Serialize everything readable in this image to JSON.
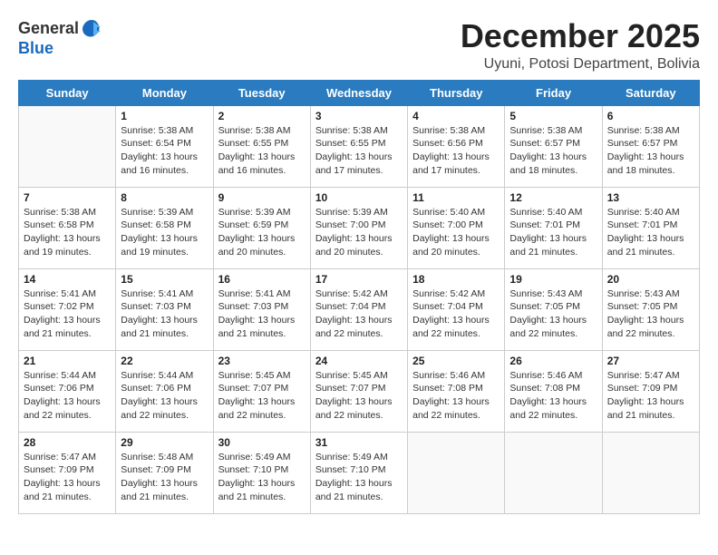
{
  "logo": {
    "text_general": "General",
    "text_blue": "Blue",
    "icon": "▶"
  },
  "title": "December 2025",
  "subtitle": "Uyuni, Potosi Department, Bolivia",
  "days_of_week": [
    "Sunday",
    "Monday",
    "Tuesday",
    "Wednesday",
    "Thursday",
    "Friday",
    "Saturday"
  ],
  "weeks": [
    [
      {
        "day": "",
        "info": ""
      },
      {
        "day": "1",
        "info": "Sunrise: 5:38 AM\nSunset: 6:54 PM\nDaylight: 13 hours and 16 minutes."
      },
      {
        "day": "2",
        "info": "Sunrise: 5:38 AM\nSunset: 6:55 PM\nDaylight: 13 hours and 16 minutes."
      },
      {
        "day": "3",
        "info": "Sunrise: 5:38 AM\nSunset: 6:55 PM\nDaylight: 13 hours and 17 minutes."
      },
      {
        "day": "4",
        "info": "Sunrise: 5:38 AM\nSunset: 6:56 PM\nDaylight: 13 hours and 17 minutes."
      },
      {
        "day": "5",
        "info": "Sunrise: 5:38 AM\nSunset: 6:57 PM\nDaylight: 13 hours and 18 minutes."
      },
      {
        "day": "6",
        "info": "Sunrise: 5:38 AM\nSunset: 6:57 PM\nDaylight: 13 hours and 18 minutes."
      }
    ],
    [
      {
        "day": "7",
        "info": "Sunrise: 5:38 AM\nSunset: 6:58 PM\nDaylight: 13 hours and 19 minutes."
      },
      {
        "day": "8",
        "info": "Sunrise: 5:39 AM\nSunset: 6:58 PM\nDaylight: 13 hours and 19 minutes."
      },
      {
        "day": "9",
        "info": "Sunrise: 5:39 AM\nSunset: 6:59 PM\nDaylight: 13 hours and 20 minutes."
      },
      {
        "day": "10",
        "info": "Sunrise: 5:39 AM\nSunset: 7:00 PM\nDaylight: 13 hours and 20 minutes."
      },
      {
        "day": "11",
        "info": "Sunrise: 5:40 AM\nSunset: 7:00 PM\nDaylight: 13 hours and 20 minutes."
      },
      {
        "day": "12",
        "info": "Sunrise: 5:40 AM\nSunset: 7:01 PM\nDaylight: 13 hours and 21 minutes."
      },
      {
        "day": "13",
        "info": "Sunrise: 5:40 AM\nSunset: 7:01 PM\nDaylight: 13 hours and 21 minutes."
      }
    ],
    [
      {
        "day": "14",
        "info": "Sunrise: 5:41 AM\nSunset: 7:02 PM\nDaylight: 13 hours and 21 minutes."
      },
      {
        "day": "15",
        "info": "Sunrise: 5:41 AM\nSunset: 7:03 PM\nDaylight: 13 hours and 21 minutes."
      },
      {
        "day": "16",
        "info": "Sunrise: 5:41 AM\nSunset: 7:03 PM\nDaylight: 13 hours and 21 minutes."
      },
      {
        "day": "17",
        "info": "Sunrise: 5:42 AM\nSunset: 7:04 PM\nDaylight: 13 hours and 22 minutes."
      },
      {
        "day": "18",
        "info": "Sunrise: 5:42 AM\nSunset: 7:04 PM\nDaylight: 13 hours and 22 minutes."
      },
      {
        "day": "19",
        "info": "Sunrise: 5:43 AM\nSunset: 7:05 PM\nDaylight: 13 hours and 22 minutes."
      },
      {
        "day": "20",
        "info": "Sunrise: 5:43 AM\nSunset: 7:05 PM\nDaylight: 13 hours and 22 minutes."
      }
    ],
    [
      {
        "day": "21",
        "info": "Sunrise: 5:44 AM\nSunset: 7:06 PM\nDaylight: 13 hours and 22 minutes."
      },
      {
        "day": "22",
        "info": "Sunrise: 5:44 AM\nSunset: 7:06 PM\nDaylight: 13 hours and 22 minutes."
      },
      {
        "day": "23",
        "info": "Sunrise: 5:45 AM\nSunset: 7:07 PM\nDaylight: 13 hours and 22 minutes."
      },
      {
        "day": "24",
        "info": "Sunrise: 5:45 AM\nSunset: 7:07 PM\nDaylight: 13 hours and 22 minutes."
      },
      {
        "day": "25",
        "info": "Sunrise: 5:46 AM\nSunset: 7:08 PM\nDaylight: 13 hours and 22 minutes."
      },
      {
        "day": "26",
        "info": "Sunrise: 5:46 AM\nSunset: 7:08 PM\nDaylight: 13 hours and 22 minutes."
      },
      {
        "day": "27",
        "info": "Sunrise: 5:47 AM\nSunset: 7:09 PM\nDaylight: 13 hours and 21 minutes."
      }
    ],
    [
      {
        "day": "28",
        "info": "Sunrise: 5:47 AM\nSunset: 7:09 PM\nDaylight: 13 hours and 21 minutes."
      },
      {
        "day": "29",
        "info": "Sunrise: 5:48 AM\nSunset: 7:09 PM\nDaylight: 13 hours and 21 minutes."
      },
      {
        "day": "30",
        "info": "Sunrise: 5:49 AM\nSunset: 7:10 PM\nDaylight: 13 hours and 21 minutes."
      },
      {
        "day": "31",
        "info": "Sunrise: 5:49 AM\nSunset: 7:10 PM\nDaylight: 13 hours and 21 minutes."
      },
      {
        "day": "",
        "info": ""
      },
      {
        "day": "",
        "info": ""
      },
      {
        "day": "",
        "info": ""
      }
    ]
  ]
}
